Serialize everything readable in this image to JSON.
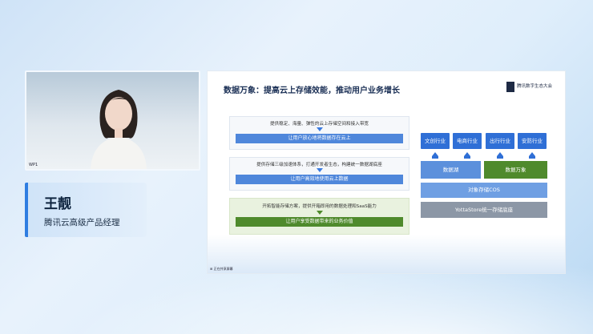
{
  "speaker": {
    "name": "王靓",
    "title": "腾讯云高级产品经理",
    "camera_label": "WP1"
  },
  "slide": {
    "title": "数据万象：提高云上存储效能，推动用户业务增长",
    "logo_text": "腾讯数字生态大会",
    "boxes": [
      {
        "text": "提供稳定、海量、弹性的云上存储空间和接入带宽",
        "bar": "让用户放心地将数据存在云上"
      },
      {
        "text": "提供存储三级加速体系，打通开发者生态，构建统一数据湖底座",
        "bar": "让用户高效地使用云上数据"
      },
      {
        "text": "开拓智能存储方案，提供开箱即用的数据处理和SaaS能力",
        "bar": "让用户享受数据带来的业务价值"
      }
    ],
    "industries": [
      "文创行业",
      "电商行业",
      "出行行业",
      "安防行业"
    ],
    "data_lake": "数据湖",
    "data_wanxiang": "数据万象",
    "cos": "对象存储COS",
    "yotta": "YottaStore统一存储底座",
    "taskbar_label": "⊞ 正在共享屏幕"
  }
}
